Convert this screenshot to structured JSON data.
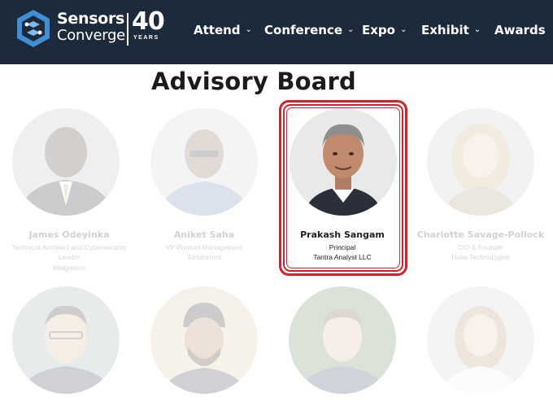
{
  "header": {
    "logo_line1": "Sensors",
    "logo_line2": "Converge",
    "logo_number": "40",
    "logo_years": "YEARS",
    "nav": [
      {
        "label": "Attend",
        "chevron": "chevron-down-icon"
      },
      {
        "label": "Conference",
        "chevron": "chevron-down-icon"
      },
      {
        "label": "Expo",
        "chevron": "chevron-down-icon"
      },
      {
        "label": "Exhibit",
        "chevron": "chevron-down-icon"
      },
      {
        "label": "Awards"
      }
    ],
    "colors": {
      "background": "#1c2a3b",
      "text": "#ffffff",
      "logo_blue": "#3f8fd6"
    }
  },
  "main": {
    "title": "Advisory Board",
    "highlight_color": "#d4202a",
    "members": [
      {
        "name": "James Odeyinka",
        "lines": [
          "Technical Architect and Cybersecurity",
          "Leader",
          "Walgreens"
        ],
        "highlighted": false
      },
      {
        "name": "Aniket Saha",
        "lines": [
          "VP Product Management",
          "Tenstorrent"
        ],
        "highlighted": false
      },
      {
        "name": "Prakash Sangam",
        "lines": [
          "Principal",
          "Tantra Analyst LLC"
        ],
        "highlighted": true
      },
      {
        "name": "Charlotte Savage-Pollock",
        "lines": [
          "CIO & Founder",
          "Halia Technologies"
        ],
        "highlighted": false
      }
    ],
    "second_row_count": 4
  }
}
